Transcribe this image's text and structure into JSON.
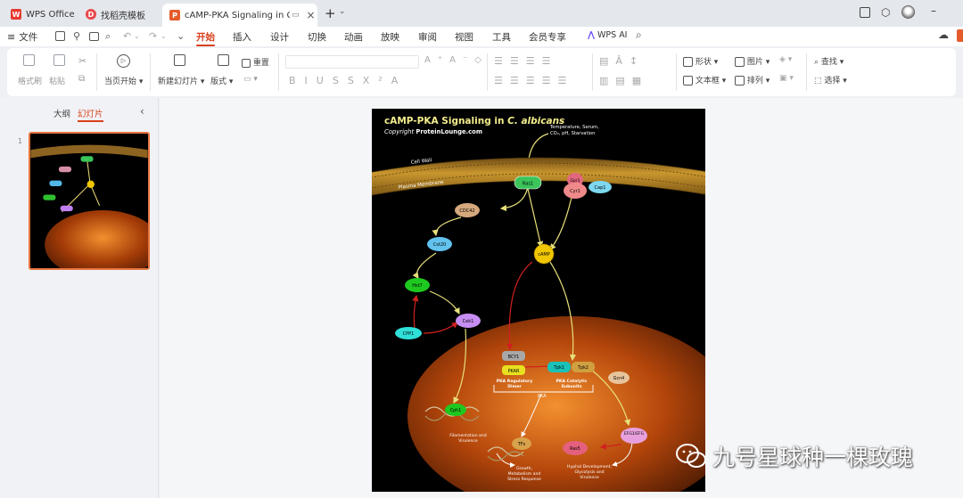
{
  "tabs": [
    {
      "label": "WPS Office",
      "logo": "W"
    },
    {
      "label": "找稻壳模板",
      "logo": "D"
    },
    {
      "label": "cAMP-PKA Signaling in C. al",
      "logo": "P"
    }
  ],
  "menu": {
    "file": "文件",
    "items": [
      "开始",
      "插入",
      "设计",
      "切换",
      "动画",
      "放映",
      "审阅",
      "视图",
      "工具",
      "会员专享"
    ],
    "ai": "WPS AI"
  },
  "ribbon": {
    "format_painter": "格式刷",
    "paste": "粘贴",
    "from_start": "当页开始",
    "new_slide": "新建幻灯片",
    "layout": "版式",
    "reset": "重置",
    "shape": "形状",
    "picture": "图片",
    "textbox": "文本框",
    "arrange": "排列",
    "find": "查找",
    "select": "选择"
  },
  "panel": {
    "outline": "大纲",
    "slides": "幻灯片",
    "slide_number": "1"
  },
  "slide": {
    "title_main": "cAMP-PKA Signaling in ",
    "title_italic": "C. albicans",
    "copyright_prefix": "Copyright ",
    "copyright_site": "ProteinLounge.com",
    "signal_line1": "Temperature, Serum,",
    "signal_line2": "CO₂, pH, Starvation",
    "cell_wall": "Cell Wall",
    "plasma_membrane": "Plasma Membrane",
    "nodes": {
      "ras1": "Ras1",
      "gpr1": "Gpr1",
      "cyr1": "Cyr1",
      "cap1": "Cap1",
      "cdc42": "CDC42",
      "cst20": "Cst20",
      "hst7": "Hst7",
      "cek1": "Cek1",
      "cpp1": "CPP1",
      "camp": "cAMP",
      "bcy1": "BCY1",
      "pkar": "PKAR",
      "tpk1": "Tpk1",
      "tpk2": "Tpk2",
      "gcn4": "Gcn4",
      "efg1": "EFG1/EFG",
      "cph1": "Cph1",
      "tf": "TFs",
      "ras5": "Ras5"
    },
    "labels": {
      "pka_reg": [
        "PKA Regulatory",
        "Dimer"
      ],
      "pka_cat": [
        "PKA Catalytic",
        "Subunits"
      ],
      "pka": "PKA",
      "filament": [
        "Filamentation and",
        "Virulence"
      ],
      "growth": [
        "Growth,",
        "Metabolism and",
        "Stress Response"
      ],
      "hyphal": [
        "Hyphal Development,",
        "Glycolysis and",
        "Virulence"
      ]
    }
  },
  "watermark": "九号星球种一棵玫瑰"
}
